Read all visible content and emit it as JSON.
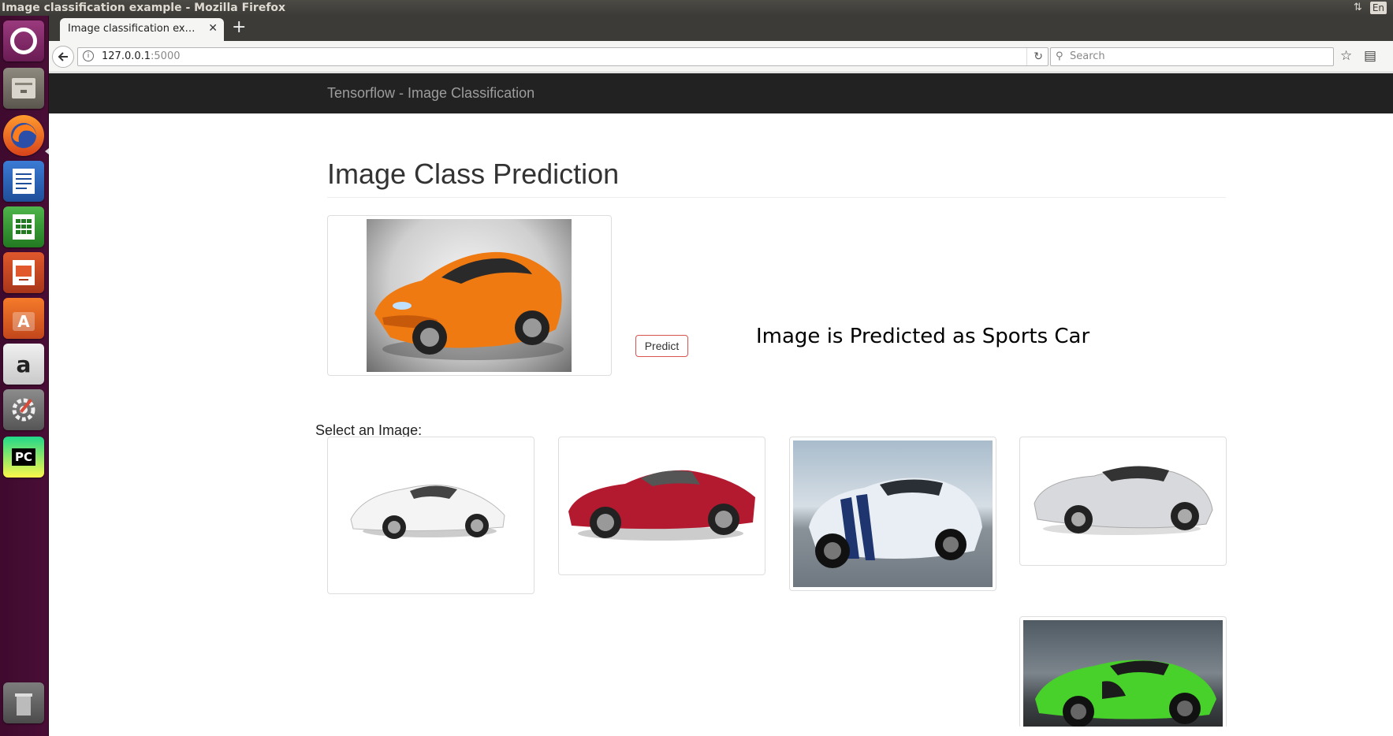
{
  "os": {
    "window_title": "Image classification example - Mozilla Firefox",
    "indicators": {
      "network_icon": "up-down-arrows-icon",
      "language": "En"
    },
    "launcher": [
      {
        "name": "ubuntu-dash-icon"
      },
      {
        "name": "files-icon"
      },
      {
        "name": "firefox-icon"
      },
      {
        "name": "libreoffice-writer-icon"
      },
      {
        "name": "libreoffice-calc-icon"
      },
      {
        "name": "libreoffice-impress-icon"
      },
      {
        "name": "software-center-icon"
      },
      {
        "name": "amazon-icon",
        "glyph": "a"
      },
      {
        "name": "system-settings-icon"
      },
      {
        "name": "pycharm-icon",
        "glyph": "PC"
      },
      {
        "name": "trash-icon"
      }
    ]
  },
  "browser": {
    "tab_title": "Image classification ex…",
    "url_host": "127.0.0.1",
    "url_port": ":5000",
    "search_placeholder": "Search"
  },
  "page": {
    "brand": "Tensorflow - Image Classification",
    "heading": "Image Class Prediction",
    "predict_label": "Predict",
    "prediction_text": "Image is Predicted as Sports Car",
    "select_label": "Select an Image:",
    "gallery": [
      {
        "name": "white-sports-car-image",
        "color": "#ffffff"
      },
      {
        "name": "red-convertible-image",
        "color": "#b31a2f"
      },
      {
        "name": "white-mustang-striped-image",
        "color": "#e8eef3"
      },
      {
        "name": "silver-corvette-image",
        "color": "#d7d9dc"
      },
      {
        "name": "green-mclaren-image",
        "color": "#47d12a"
      }
    ],
    "selected_image": {
      "name": "orange-sports-car-image",
      "color": "#f07a12"
    }
  }
}
